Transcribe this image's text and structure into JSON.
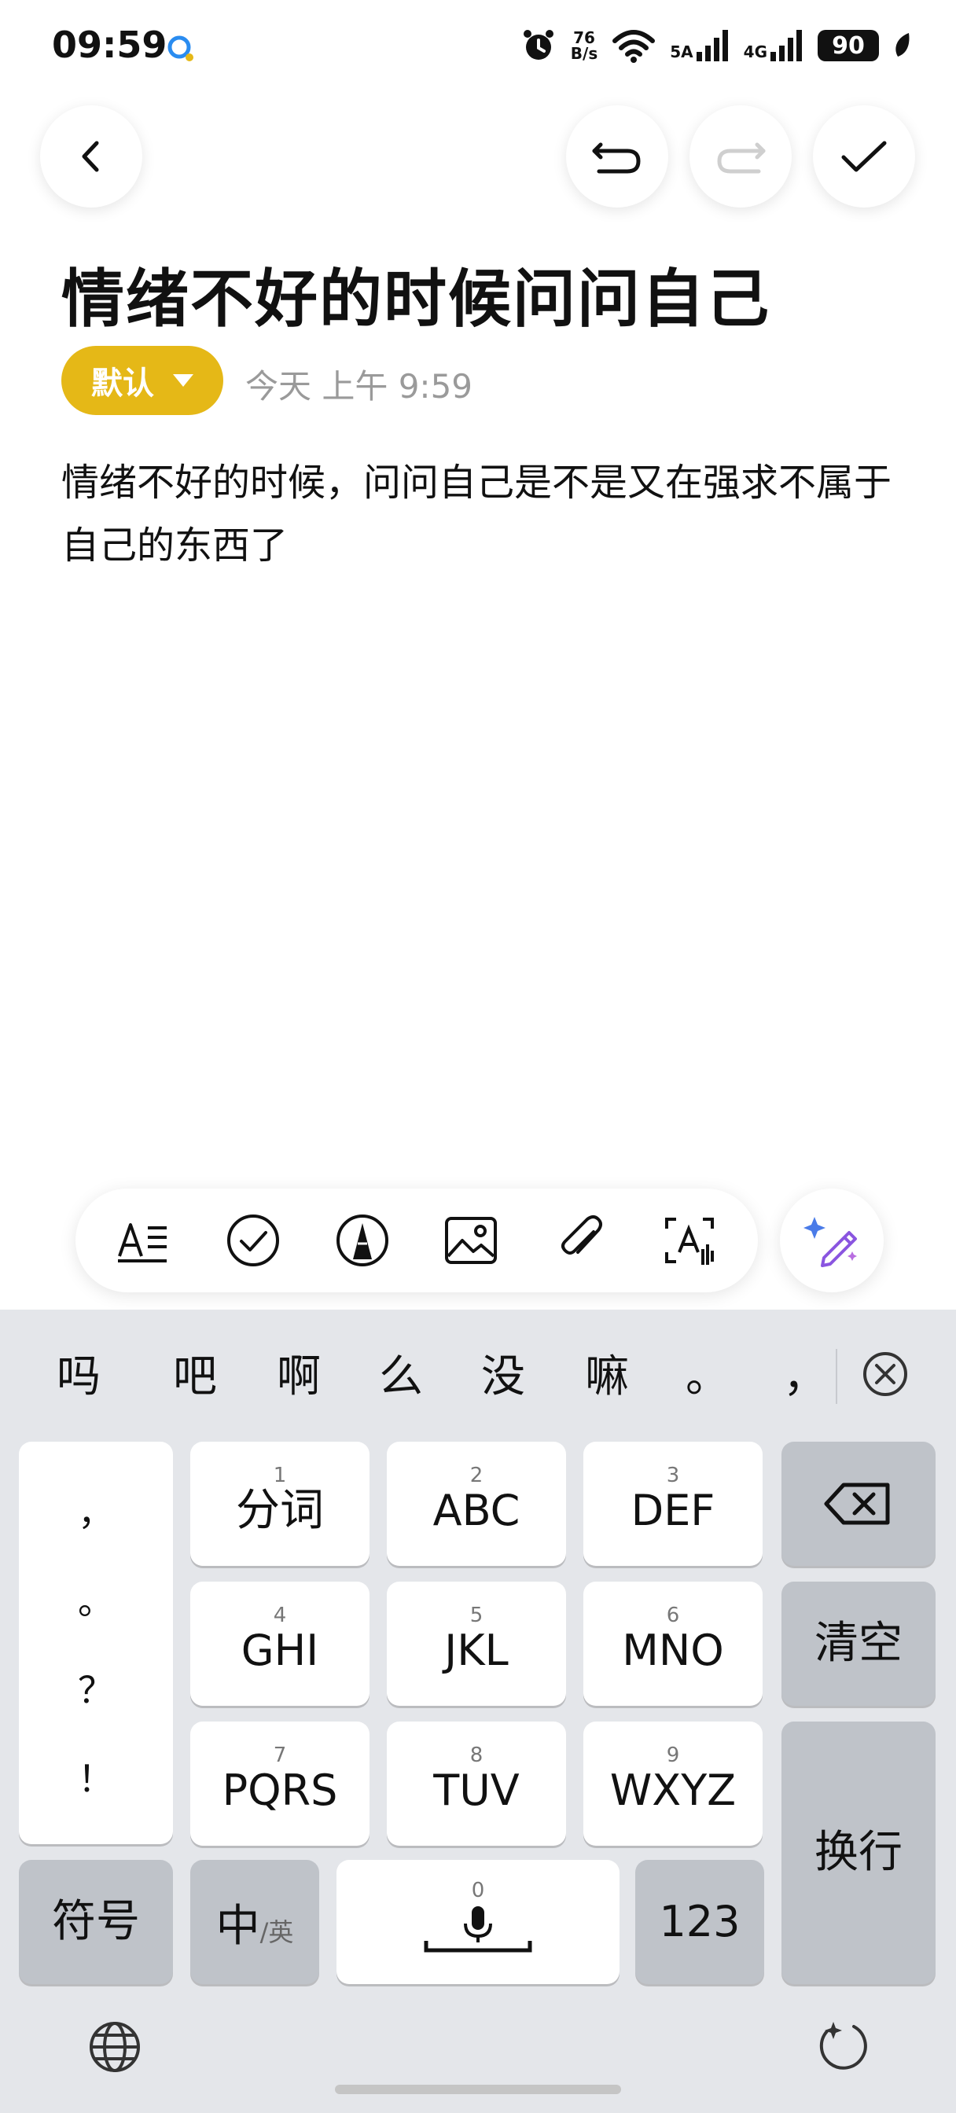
{
  "status_bar": {
    "time": "09:59",
    "net_speed_top": "76",
    "net_speed_bottom": "B/s",
    "wifi_label": "5A",
    "cell_label": "4G",
    "battery": "90"
  },
  "note": {
    "title": "情绪不好的时候问问自己",
    "category": "默认",
    "timestamp": "今天 上午 9:59",
    "body": "情绪不好的时候，问问自己是不是又在强求不属于自己的东西了"
  },
  "toolbar": {
    "icons": [
      "text-format-icon",
      "checklist-icon",
      "pen-icon",
      "image-icon",
      "attachment-icon",
      "scan-text-icon"
    ],
    "ai_icon": "ai-magic-pen-icon"
  },
  "keyboard": {
    "candidates": [
      "吗",
      "吧",
      "啊",
      "么",
      "没",
      "嘛",
      "。",
      "，"
    ],
    "punctuation": [
      "，",
      "。",
      "？",
      "！"
    ],
    "keys": [
      {
        "num": "1",
        "label": "分词"
      },
      {
        "num": "2",
        "label": "ABC"
      },
      {
        "num": "3",
        "label": "DEF"
      },
      {
        "num": "4",
        "label": "GHI"
      },
      {
        "num": "5",
        "label": "JKL"
      },
      {
        "num": "6",
        "label": "MNO"
      },
      {
        "num": "7",
        "label": "PQRS"
      },
      {
        "num": "8",
        "label": "TUV"
      },
      {
        "num": "9",
        "label": "WXYZ"
      }
    ],
    "clear_label": "清空",
    "enter_label": "换行",
    "symbols_label": "符号",
    "lang_zh": "中",
    "lang_en": "/英",
    "space_num": "0",
    "num_label": "123"
  },
  "colors": {
    "accent": "#e5b817",
    "keyboard_bg": "#e4e6ea",
    "function_key": "#bfc3c9"
  }
}
